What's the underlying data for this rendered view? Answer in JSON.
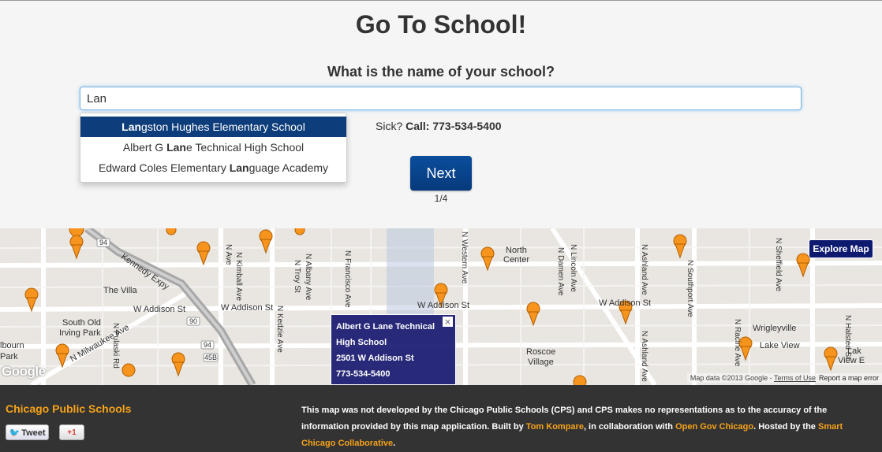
{
  "header": {
    "title": "Go To School!",
    "question": "What is the name of your school?"
  },
  "search": {
    "value": "Lan",
    "placeholder": ""
  },
  "suggestions": [
    {
      "match": "Lan",
      "rest": "gston Hughes Elementary School",
      "active": true
    },
    {
      "prefix": "Albert G ",
      "match": "Lan",
      "rest": "e Technical High School"
    },
    {
      "prefix": "Edward Coles Elementary ",
      "match": "Lan",
      "rest": "guage Academy"
    }
  ],
  "sick": {
    "label": "Sick?",
    "call": "Call: 773-534-5400"
  },
  "next_label": "Next",
  "pager": "1/4",
  "map": {
    "explore_label": "Explore Map",
    "labels": {
      "the_villa": "The Villa",
      "south_old": "South Old",
      "irving_park": "Irving Park",
      "elbourn": "lbourn",
      "park": "Park",
      "w_addison_1": "W Addison St",
      "w_addison_2": "W Addison St",
      "w_addison_3": "W Addison St",
      "north_center_1": "North",
      "north_center_2": "Center",
      "roscoe_1": "Roscoe",
      "roscoe_2": "Village",
      "wrigleyville": "Wrigleyville",
      "lake_view": "Lake View",
      "lake_view_e1": "Lak",
      "lake_view_e2": "View E",
      "kennedy": "Kennedy Expy",
      "milwaukee": "N Milwaukee Ave",
      "pulaski": "N Pulaski Rd",
      "kimball": "N Kimball Ave",
      "troy": "N Troy St",
      "albany": "N Albany Ave",
      "francisco": "N Francisco Ave",
      "kedzie": "N Kedzie Ave",
      "western": "N Western Ave",
      "lincoln": "N Lincoln Ave",
      "damen": "N Damen Ave",
      "ashland": "N Ashland Ave",
      "southport": "N Southport Ave",
      "sheffield": "N Sheffield Ave",
      "racine": "N Racine Ave",
      "halsted": "N Halsted St",
      "ave_frag": "N Ave",
      "hwy_94": "94",
      "hwy_90": "90",
      "hwy_94b": "94",
      "hwy_45b": "45B"
    },
    "popup": {
      "line1": "Albert G Lane Technical",
      "line2": "High School",
      "line3": "2501 W Addison St",
      "line4": "773-534-5400"
    },
    "google": "Google",
    "map_data": "Map data ©2013 Google -",
    "terms": "Terms of Use",
    "report": "Report a map error",
    "marker_color": "#f7941d"
  },
  "footer": {
    "org": "Chicago Public Schools",
    "tweet_label": "Tweet",
    "gplus_label": "+1",
    "disclaimer_1": "This map was not developed by the Chicago Public Schools (CPS) and CPS makes no representations as to the accuracy of the information provided by this map application. Built by ",
    "link_1": "Tom Kompare",
    "disclaimer_2": ", in collaboration with ",
    "link_2": "Open Gov Chicago",
    "disclaimer_3": ". Hosted by the ",
    "link_3": "Smart Chicago Collaborative",
    "disclaimer_4": "."
  }
}
